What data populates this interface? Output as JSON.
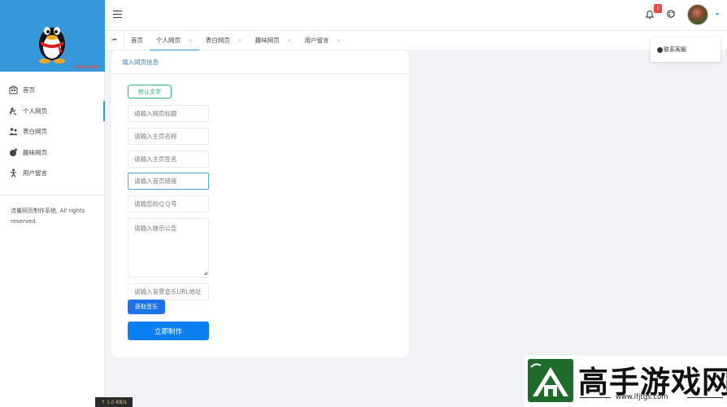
{
  "sidebar": {
    "logo_tag": "FREEGEN.NET",
    "items": [
      {
        "label": "首页",
        "icon": "home-icon"
      },
      {
        "label": "个人网页",
        "icon": "person-icon"
      },
      {
        "label": "表白网页",
        "icon": "couple-icon"
      },
      {
        "label": "趣味网页",
        "icon": "fun-icon"
      },
      {
        "label": "用户留言",
        "icon": "message-icon"
      }
    ],
    "active_index": 1,
    "footer": "流量网页制作系统, All rights reserved."
  },
  "header": {
    "notification_count": "1"
  },
  "tabs": [
    {
      "label": "首页",
      "closable": false
    },
    {
      "label": "个人网页",
      "closable": true
    },
    {
      "label": "表白网页",
      "closable": true
    },
    {
      "label": "趣味网页",
      "closable": true
    },
    {
      "label": "用户留言",
      "closable": true
    }
  ],
  "tab_close_glyph": "×",
  "dropdown": {
    "item": "联系客服"
  },
  "form": {
    "title": "填入网页信息",
    "default_text_button": "默认文字",
    "fields": {
      "page_title": "请输入网页标题",
      "home_name": "请输入主页名称",
      "home_signature": "请输入主页签名",
      "home_link": "请输入首页链接",
      "qq": "请输您的ＱＱ号",
      "notice": "请输入提示公告",
      "music_url": "请输入背景音乐URL地址"
    },
    "get_music_button": "获取音乐",
    "submit_button": "立即制作"
  },
  "speed_indicator": "↑ 1.0 KB/s",
  "watermark": {
    "title": "高手游戏网",
    "url": "www.lfjtgs.com"
  },
  "colors": {
    "accent": "#3498db",
    "primary_button": "#0b7ff0",
    "default_button": "#2ab27b",
    "badge": "#e74c3c"
  }
}
